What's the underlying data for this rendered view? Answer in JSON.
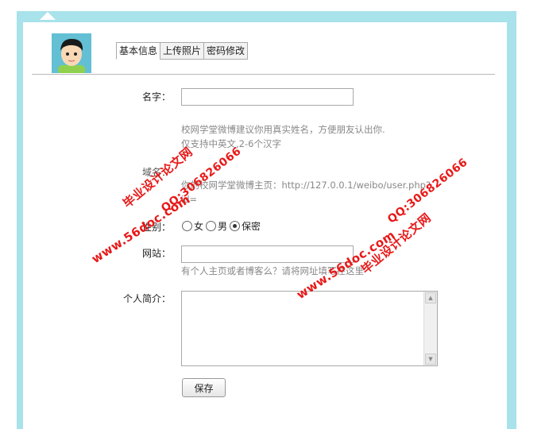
{
  "tabs": [
    {
      "label": "基本信息",
      "active": true
    },
    {
      "label": "上传照片",
      "active": false
    },
    {
      "label": "密码修改",
      "active": false
    }
  ],
  "form": {
    "name_label": "名字：",
    "name_value": "",
    "name_hint_line1": "校网学堂微博建议你用真实姓名，方便朋友认出你.",
    "name_hint_line2": "仅支持中英文,2-6个汉字",
    "domain_label": "域名：",
    "domain_hint_line1": "你的校网学堂微博主页：http://127.0.0.1/weibo/user.php?",
    "domain_hint_line2": "id=",
    "gender_label": "性别：",
    "gender_options": [
      {
        "label": "女",
        "checked": false
      },
      {
        "label": "男",
        "checked": false
      },
      {
        "label": "保密",
        "checked": true
      }
    ],
    "website_label": "网站：",
    "website_value": "",
    "website_hint": "有个人主页或者博客么？请将网址填写在这里",
    "bio_label": "个人简介：",
    "bio_value": "",
    "save_label": "保存"
  },
  "watermark": {
    "site": "www.56doc.com",
    "qq": "QQ:306826066",
    "name": "毕业设计论文网"
  },
  "colors": {
    "frame": "#a8e2ea",
    "watermark": "#e81919"
  }
}
